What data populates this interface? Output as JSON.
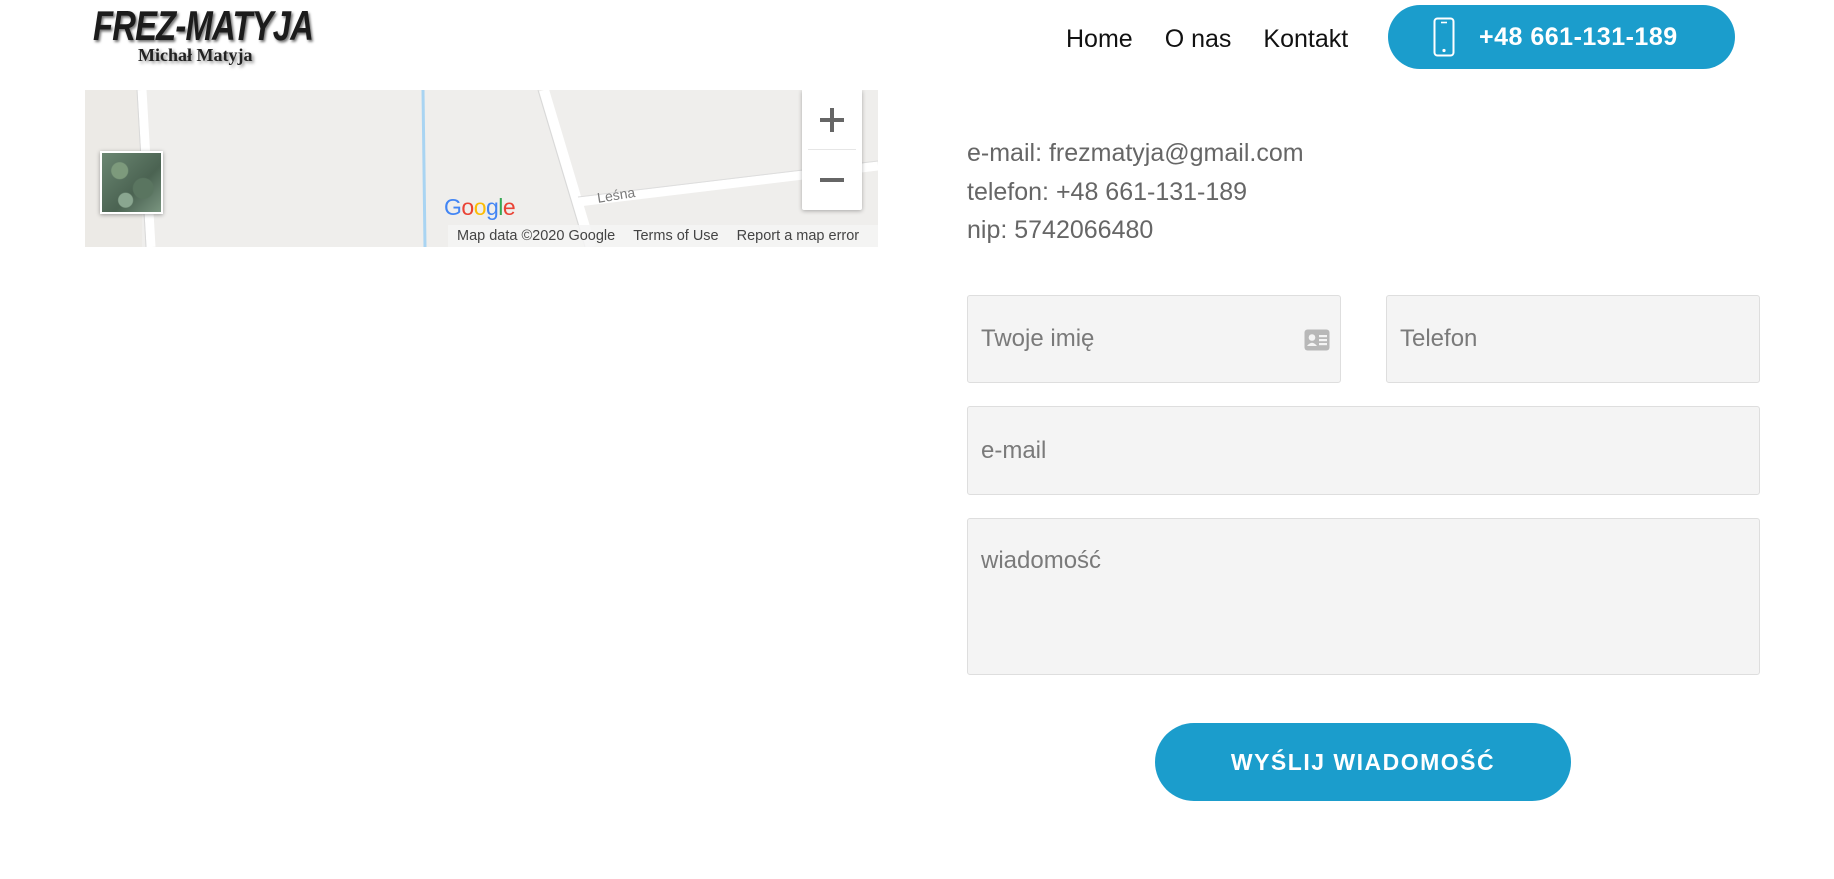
{
  "header": {
    "logo_main": "FREZ-MATYJA",
    "logo_sub": "Michał Matyja",
    "nav": [
      {
        "label": "Home"
      },
      {
        "label": "O nas"
      },
      {
        "label": "Kontakt"
      }
    ],
    "phone_button": {
      "label": "+48 661-131-189",
      "icon": "mobile-phone-icon"
    }
  },
  "map": {
    "street_label": "Leśna",
    "google_logo": "Google",
    "attribution": {
      "map_data": "Map data ©2020 Google",
      "terms": "Terms of Use",
      "report": "Report a map error"
    },
    "zoom_in_icon": "plus-icon",
    "zoom_out_icon": "minus-icon"
  },
  "contact": {
    "email_line": "e-mail: frezmatyja@gmail.com",
    "phone_line": "telefon: +48 661-131-189",
    "nip_line": "nip: 5742066480"
  },
  "form": {
    "name_placeholder": "Twoje imię",
    "phone_placeholder": "Telefon",
    "email_placeholder": "e-mail",
    "message_placeholder": "wiadomość",
    "submit_label": "WYŚLIJ WIADOMOŚĆ"
  },
  "colors": {
    "accent": "#1b9dcc",
    "field_bg": "#f4f4f4",
    "text_muted": "#666666"
  }
}
